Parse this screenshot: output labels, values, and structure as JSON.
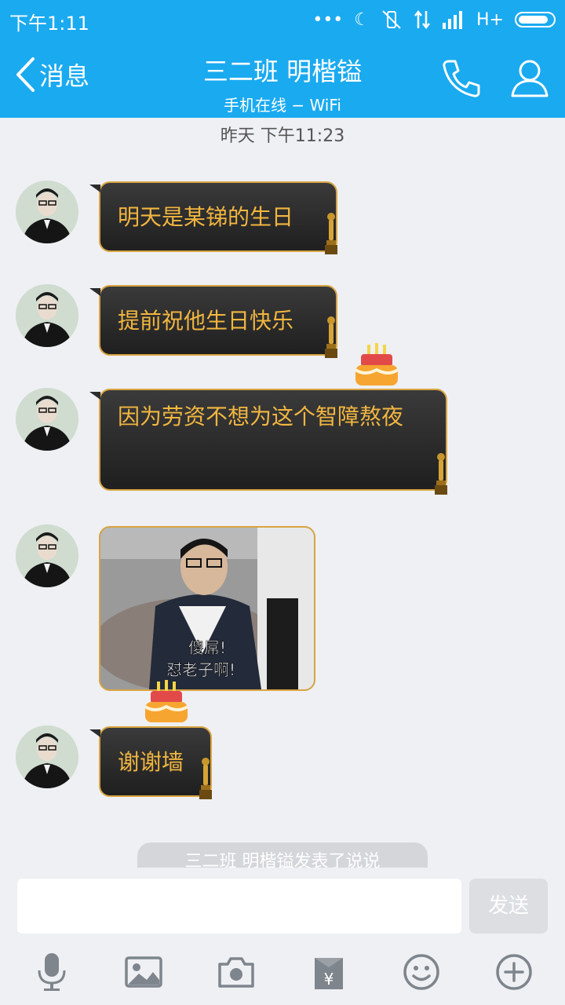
{
  "status_bar": {
    "time": "下午1:11",
    "network": "H+"
  },
  "header": {
    "back_label": "消息",
    "title": "三二班  明楷镒",
    "subtitle": "手机在线 − WiFi"
  },
  "timestamp": "昨天 下午11:23",
  "messages": [
    {
      "type": "text",
      "text": "明天是某锑的生日"
    },
    {
      "type": "text",
      "text": "提前祝他生日快乐"
    },
    {
      "type": "text",
      "text": "因为劳资不想为这个智障熬夜"
    },
    {
      "type": "image",
      "caption_line1": "傻屌!",
      "caption_line2": "怼老子啊!"
    },
    {
      "type": "text",
      "text": "谢谢墙"
    }
  ],
  "notice": "三二班  明楷镒发表了说说",
  "input": {
    "value": "",
    "send_label": "发送"
  },
  "toolbar": [
    "microphone-icon",
    "image-icon",
    "camera-icon",
    "red-packet-icon",
    "emoji-icon",
    "plus-icon"
  ],
  "colors": {
    "header": "#1aaaf0",
    "bubble_text": "#f2b640",
    "bubble_border": "#d9a441",
    "background": "#eef0f4"
  }
}
